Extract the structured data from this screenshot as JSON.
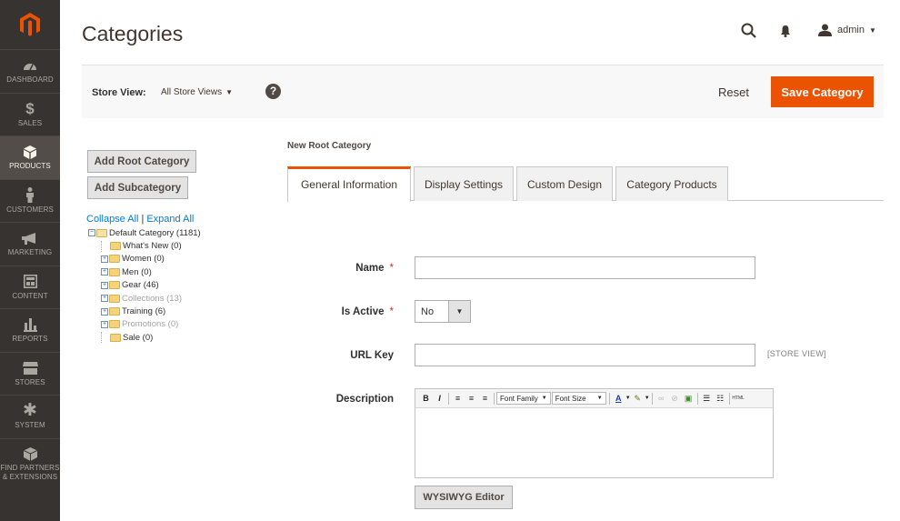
{
  "sidebar": {
    "logo_icon": "magento-logo-icon",
    "items": [
      {
        "label": "DASHBOARD",
        "icon": "dashboard-icon"
      },
      {
        "label": "SALES",
        "icon": "dollar-icon"
      },
      {
        "label": "PRODUCTS",
        "icon": "cube-icon",
        "active": true
      },
      {
        "label": "CUSTOMERS",
        "icon": "person-icon"
      },
      {
        "label": "MARKETING",
        "icon": "megaphone-icon"
      },
      {
        "label": "CONTENT",
        "icon": "layout-icon"
      },
      {
        "label": "REPORTS",
        "icon": "bar-chart-icon"
      },
      {
        "label": "STORES",
        "icon": "store-icon"
      },
      {
        "label": "SYSTEM",
        "icon": "gear-icon"
      },
      {
        "label": "FIND PARTNERS & EXTENSIONS",
        "icon": "box-icon"
      }
    ]
  },
  "header": {
    "title": "Categories",
    "user": "admin"
  },
  "action_bar": {
    "store_view_label": "Store View:",
    "store_view_value": "All Store Views",
    "help": "?",
    "reset_label": "Reset",
    "save_label": "Save Category"
  },
  "tree_panel": {
    "add_root_label": "Add Root Category",
    "add_sub_label": "Add Subcategory",
    "collapse_label": "Collapse All",
    "separator": "|",
    "expand_label": "Expand All",
    "root": "Default Category (1181)",
    "children": [
      {
        "label": "What's New (0)",
        "expandable": false,
        "muted": false
      },
      {
        "label": "Women (0)",
        "expandable": true,
        "muted": false
      },
      {
        "label": "Men (0)",
        "expandable": true,
        "muted": false
      },
      {
        "label": "Gear (46)",
        "expandable": true,
        "muted": false
      },
      {
        "label": "Collections (13)",
        "expandable": true,
        "muted": true
      },
      {
        "label": "Training (6)",
        "expandable": true,
        "muted": false
      },
      {
        "label": "Promotions (0)",
        "expandable": true,
        "muted": true
      },
      {
        "label": "Sale (0)",
        "expandable": false,
        "muted": false
      }
    ]
  },
  "form": {
    "section_title": "New Root Category",
    "tabs": [
      "General Information",
      "Display Settings",
      "Custom Design",
      "Category Products"
    ],
    "active_tab": "General Information",
    "name_label": "Name",
    "name_value": "",
    "is_active_label": "Is Active",
    "is_active_value": "No",
    "url_key_label": "URL Key",
    "url_key_value": "",
    "url_scope": "[STORE VIEW]",
    "description_label": "Description",
    "required_mark": "*",
    "toolbar": {
      "font_family": "Font Family",
      "font_size": "Font Size",
      "html_label": "HTML"
    },
    "wysiwyg_label": "WYSIWYG Editor"
  },
  "colors": {
    "sidebar_bg": "#373330",
    "accent": "#eb5202",
    "link": "#007bdb"
  }
}
